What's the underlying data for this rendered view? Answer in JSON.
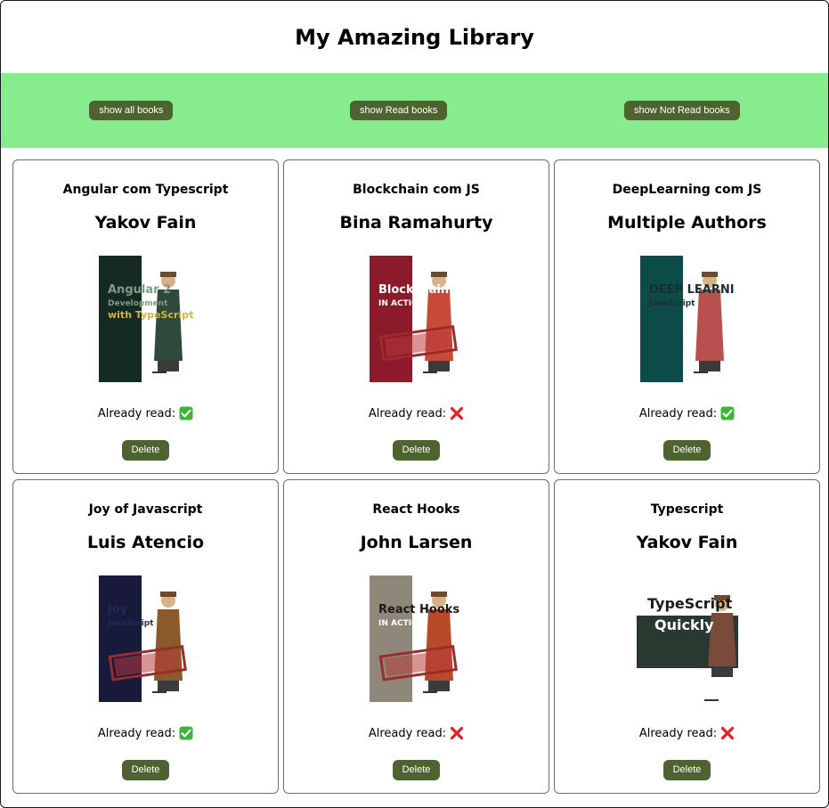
{
  "app": {
    "title": "My Amazing Library"
  },
  "filters": {
    "show_all": "show all books",
    "show_read": "show Read books",
    "show_not_read": "show Not Read books"
  },
  "labels": {
    "already_read": "Already read:",
    "delete": "Delete"
  },
  "colors": {
    "filter_bar": "#86ec8d",
    "button": "#4f6330",
    "read_icon": "#3fb43a",
    "not_read_icon": "#e0202a"
  },
  "books": [
    {
      "title": "Angular com Typescript",
      "author": "Yakov Fain",
      "read": true,
      "cover": {
        "band": "#152a24",
        "bg": "#ffffff",
        "line1": "Angular 2",
        "line2": "Development",
        "line3": "with TypeScript",
        "line1_color": "#7f9b84",
        "line3_color": "#d3b23d",
        "meap": false
      }
    },
    {
      "title": "Blockchain com JS",
      "author": "Bina Ramahurty",
      "read": false,
      "cover": {
        "band": "#8c1a2a",
        "bg": "#ffffff",
        "line1": "Blockchain",
        "line2": "IN ACTION",
        "line3": "",
        "line1_color": "#ffffff",
        "line3_color": "#ffffff",
        "meap": true
      }
    },
    {
      "title": "DeepLearning com JS",
      "author": "Multiple Authors",
      "read": true,
      "cover": {
        "band": "#0d4b49",
        "bg": "#ffffff",
        "line1": "DEEP LEARNING",
        "line2": "JavaScript",
        "line3": "",
        "line1_color": "#1a3030",
        "line3_color": "#1a3030",
        "meap": false
      }
    },
    {
      "title": "Joy of Javascript",
      "author": "Luis Atencio",
      "read": true,
      "cover": {
        "band": "#181a3c",
        "bg": "#ffffff",
        "line1": "Joy",
        "line2": "JavaScript",
        "line3": "",
        "line1_color": "#1d2a5a",
        "line3_color": "#1d2a5a",
        "meap": true
      }
    },
    {
      "title": "React Hooks",
      "author": "John Larsen",
      "read": false,
      "cover": {
        "band": "#8f877a",
        "bg": "#ffffff",
        "line1": "React Hooks",
        "line2": "IN ACTION",
        "line3": "",
        "line1_color": "#1a1a1a",
        "line3_color": "#ffffff",
        "meap": true
      }
    },
    {
      "title": "Typescript",
      "author": "Yakov Fain",
      "read": false,
      "cover": {
        "band": "#283a30",
        "bg": "#ffffff",
        "line1": "TypeScript",
        "line2": "Quickly",
        "line3": "",
        "line1_color": "#ffffff",
        "line3_color": "#ffffff",
        "meap": false
      }
    }
  ]
}
